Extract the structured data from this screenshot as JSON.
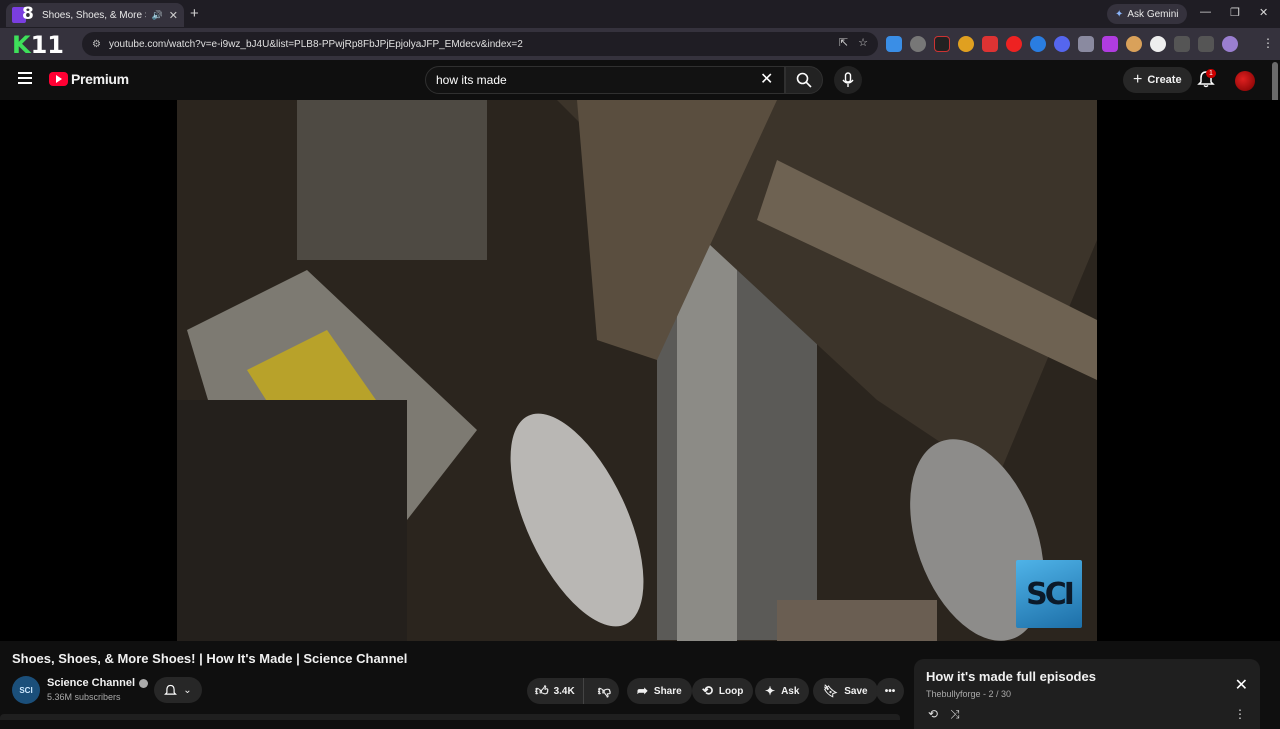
{
  "browser": {
    "tab": {
      "title": "Shoes, Shoes, & More S",
      "favicon_text": "8"
    },
    "new_tab_label": "+",
    "ask_gemini": "Ask Gemini",
    "url": "youtube.com/watch?v=e-i9wz_bJ4U&list=PLB8-PPwjRp8FbJPjEpjolyaJFP_EMdecv&index=2",
    "brand_k": "K",
    "brand_num": "11"
  },
  "header": {
    "logo_text": "Premium",
    "search_value": "how its made",
    "create_label": "Create",
    "notification_count": "1"
  },
  "video": {
    "title": "Shoes, Shoes, & More Shoes! | How It's Made | Science Channel",
    "watermark": "SCI"
  },
  "channel": {
    "name": "Science Channel",
    "subscribers": "5.36M subscribers",
    "avatar_text": "SCI"
  },
  "actions": {
    "like_count": "3.4K",
    "share": "Share",
    "loop": "Loop",
    "ask": "Ask",
    "save": "Save"
  },
  "playlist": {
    "title": "How it's made full episodes",
    "subtitle": "Thebullyforge - 2 / 30"
  },
  "colors": {
    "accent": "#ff0033",
    "background": "#0f0f0f",
    "pill": "#272727"
  }
}
